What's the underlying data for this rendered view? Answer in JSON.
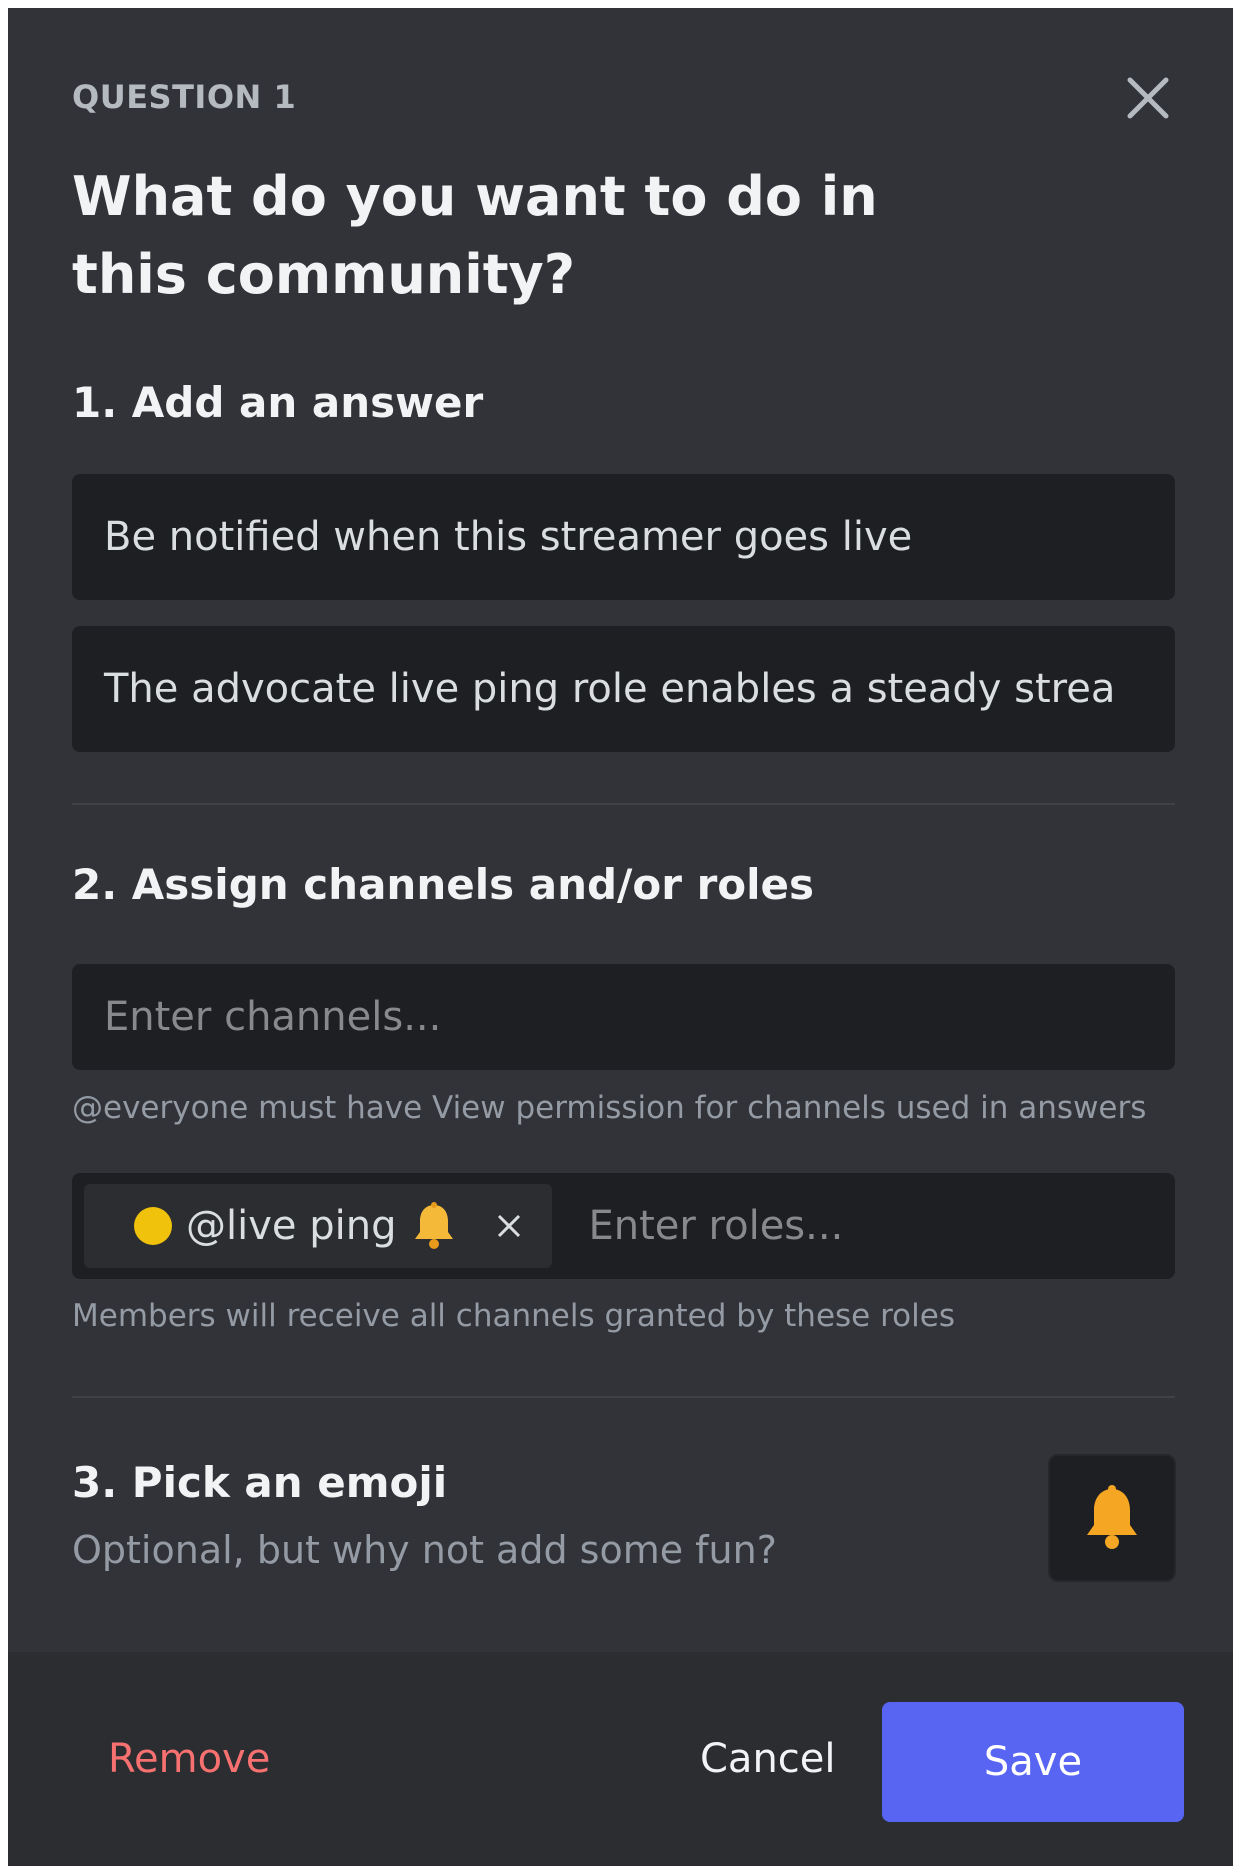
{
  "question": {
    "label": "QUESTION 1",
    "title": "What do you want to do in this community?"
  },
  "step1": {
    "heading": "1. Add an answer",
    "answer_value": "Be notified when this streamer goes live",
    "description_value": "The advocate live ping role enables a steady strea"
  },
  "step2": {
    "heading": "2. Assign channels and/or roles",
    "channels_placeholder": "Enter channels...",
    "channels_helper": "@everyone must have View permission for channels used in answers",
    "role_chip": {
      "label": "@live ping",
      "color": "#f0c20c",
      "icon": "bell-icon"
    },
    "roles_placeholder": "Enter roles...",
    "roles_helper": "Members will receive all channels granted by these roles"
  },
  "step3": {
    "heading": "3. Pick an emoji",
    "subtext": "Optional, but why not add some fun?",
    "emoji": "bell-icon"
  },
  "footer": {
    "remove_label": "Remove",
    "cancel_label": "Cancel",
    "save_label": "Save"
  },
  "colors": {
    "modal_bg": "#313338",
    "input_bg": "#1e1f22",
    "footer_bg": "#2b2d31",
    "accent": "#5865f2",
    "danger": "#f87171"
  }
}
